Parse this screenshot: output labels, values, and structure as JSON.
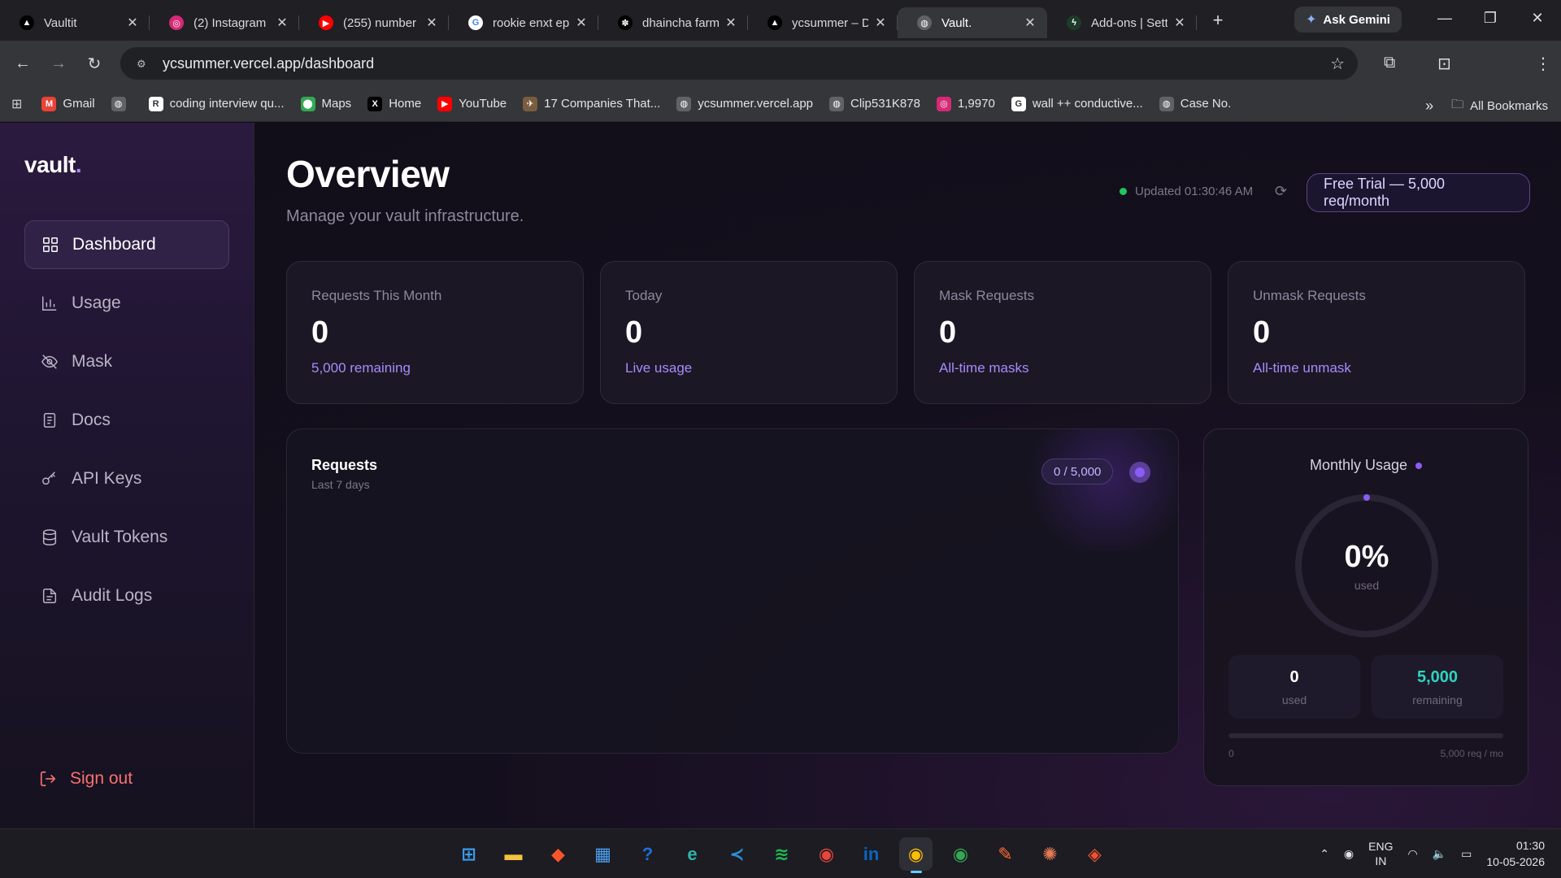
{
  "browser": {
    "tabs": [
      {
        "title": "Vaultit",
        "favicon": "vercel-triangle-icon",
        "color": "#000000",
        "glyph": "▲"
      },
      {
        "title": "(2) Instagram",
        "favicon": "instagram-icon",
        "color": "#d62976",
        "glyph": "◎"
      },
      {
        "title": "(255) number",
        "favicon": "youtube-icon",
        "color": "#ff0000",
        "glyph": "▶"
      },
      {
        "title": "rookie enxt ep",
        "favicon": "google-icon",
        "color": "#ffffff",
        "glyph": "G"
      },
      {
        "title": "dhaincha farm",
        "favicon": "wheat-icon",
        "color": "#000000",
        "glyph": "✽"
      },
      {
        "title": "ycsummer – D",
        "favicon": "vercel-triangle-icon",
        "color": "#000000",
        "glyph": "▲"
      },
      {
        "title": "Vault.",
        "favicon": "globe-icon",
        "color": "#5f6368",
        "glyph": "◍",
        "active": true
      },
      {
        "title": "Add-ons | Sett",
        "favicon": "bolt-icon",
        "color": "#1e3a2a",
        "glyph": "ϟ"
      }
    ],
    "gemini_label": "Ask Gemini",
    "url": "ycsummer.vercel.app/dashboard",
    "bookmarks": [
      {
        "label": "Gmail",
        "icon": "gmail-icon",
        "color": "#ea4335",
        "glyph": "M"
      },
      {
        "label": "",
        "icon": "globe-icon",
        "color": "#5f6368",
        "glyph": "◍"
      },
      {
        "label": "coding interview qu...",
        "icon": "r-icon",
        "color": "#ffffff",
        "glyph": "R"
      },
      {
        "label": "Maps",
        "icon": "maps-pin-icon",
        "color": "#34a853",
        "glyph": "⬤"
      },
      {
        "label": "Home",
        "icon": "x-icon",
        "color": "#000000",
        "glyph": "X"
      },
      {
        "label": "YouTube",
        "icon": "youtube-icon",
        "color": "#ff0000",
        "glyph": "▶"
      },
      {
        "label": "17 Companies That...",
        "icon": "rocket-icon",
        "color": "#7a5c3e",
        "glyph": "✈"
      },
      {
        "label": "ycsummer.vercel.app",
        "icon": "globe-icon",
        "color": "#5f6368",
        "glyph": "◍"
      },
      {
        "label": "Clip531K878",
        "icon": "globe-icon",
        "color": "#5f6368",
        "glyph": "◍"
      },
      {
        "label": "1,9970",
        "icon": "instagram-icon",
        "color": "#d62976",
        "glyph": "◎"
      },
      {
        "label": "wall ++ conductive...",
        "icon": "google-icon",
        "color": "#ffffff",
        "glyph": "G"
      },
      {
        "label": "Case No.",
        "icon": "globe-icon",
        "color": "#5f6368",
        "glyph": "◍"
      }
    ],
    "all_bookmarks_label": "All Bookmarks"
  },
  "sidebar": {
    "logo": "vault",
    "logo_dot": ".",
    "items": [
      {
        "label": "Dashboard",
        "icon": "grid-icon",
        "active": true
      },
      {
        "label": "Usage",
        "icon": "bar-chart-icon"
      },
      {
        "label": "Mask",
        "icon": "eye-off-icon"
      },
      {
        "label": "Docs",
        "icon": "document-icon"
      },
      {
        "label": "API Keys",
        "icon": "key-icon"
      },
      {
        "label": "Vault Tokens",
        "icon": "database-icon"
      },
      {
        "label": "Audit Logs",
        "icon": "file-list-icon"
      }
    ],
    "signout_label": "Sign out"
  },
  "header": {
    "title": "Overview",
    "subtitle": "Manage your vault infrastructure.",
    "updated": "Updated 01:30:46 AM",
    "trial_badge": "Free Trial — 5,000 req/month"
  },
  "stats": [
    {
      "label": "Requests This Month",
      "value": "0",
      "sub": "5,000 remaining"
    },
    {
      "label": "Today",
      "value": "0",
      "sub": "Live usage"
    },
    {
      "label": "Mask Requests",
      "value": "0",
      "sub": "All-time masks"
    },
    {
      "label": "Unmask Requests",
      "value": "0",
      "sub": "All-time unmask"
    }
  ],
  "requests_panel": {
    "title": "Requests",
    "subtitle": "Last 7 days",
    "pill": "0 / 5,000"
  },
  "monthly_usage": {
    "title": "Monthly Usage",
    "percent": "0%",
    "percent_label": "used",
    "used_value": "0",
    "used_label": "used",
    "remaining_value": "5,000",
    "remaining_label": "remaining",
    "progress_fraction": 0,
    "scale_min": "0",
    "scale_max": "5,000 req / mo",
    "remaining_color": "#2dd4bf"
  },
  "taskbar": {
    "apps": [
      {
        "icon": "windows-start-icon",
        "glyph": "⊞",
        "color": "#3b9cf0"
      },
      {
        "icon": "file-explorer-icon",
        "glyph": "▬",
        "color": "#f5c242"
      },
      {
        "icon": "brave-icon",
        "glyph": "◆",
        "color": "#fb542b"
      },
      {
        "icon": "microsoft-store-icon",
        "glyph": "▦",
        "color": "#4ea1f5"
      },
      {
        "icon": "help-icon",
        "glyph": "?",
        "color": "#1e6fd9"
      },
      {
        "icon": "edge-icon",
        "glyph": "e",
        "color": "#2fb5a8"
      },
      {
        "icon": "vscode-icon",
        "glyph": "≺",
        "color": "#2a8fd8"
      },
      {
        "icon": "spotify-icon",
        "glyph": "≋",
        "color": "#1db954"
      },
      {
        "icon": "chrome-icon",
        "glyph": "◉",
        "color": "#e8453c"
      },
      {
        "icon": "linkedin-icon",
        "glyph": "in",
        "color": "#0a66c2"
      },
      {
        "icon": "chrome-active-icon",
        "glyph": "◉",
        "color": "#fbbc04",
        "active": true
      },
      {
        "icon": "chrome-profile-icon",
        "glyph": "◉",
        "color": "#34a853"
      },
      {
        "icon": "postman-icon",
        "glyph": "✎",
        "color": "#ff6c37"
      },
      {
        "icon": "claude-icon",
        "glyph": "✺",
        "color": "#e67a55"
      },
      {
        "icon": "git-icon",
        "glyph": "◈",
        "color": "#f05032"
      }
    ],
    "lang_top": "ENG",
    "lang_bottom": "IN",
    "time": "01:30",
    "date": "10-05-2026"
  }
}
